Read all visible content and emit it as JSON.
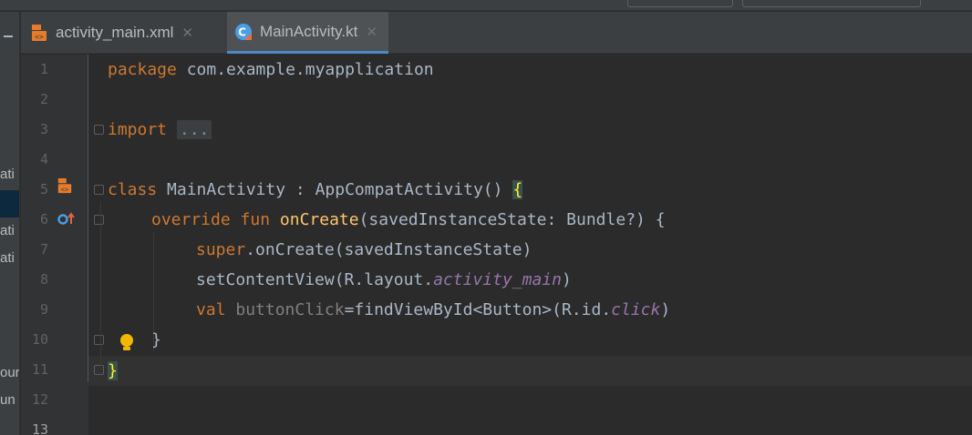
{
  "tabs": [
    {
      "label": "activity_main.xml",
      "icon": "xml-layout-icon",
      "active": false
    },
    {
      "label": "MainActivity.kt",
      "icon": "kotlin-class-icon",
      "active": true
    }
  ],
  "left_panel_fragments": [
    "ati",
    "ati",
    "ati",
    "our",
    "un"
  ],
  "line_numbers": [
    "1",
    "2",
    "3",
    "4",
    "5",
    "6",
    "7",
    "8",
    "9",
    "10",
    "11",
    "12",
    "13"
  ],
  "code": {
    "line1": {
      "kw": "package",
      "rest": " com.example.myapplication"
    },
    "line3": {
      "kw": "import",
      "folded": "..."
    },
    "line7": {
      "kw": "class",
      "rest": " MainActivity : AppCompatActivity() ",
      "brace": "{"
    },
    "line8": {
      "kw": "override fun",
      "fn": "onCreate",
      "rest": "(savedInstanceState: Bundle?) {"
    },
    "line9": {
      "kw": "super",
      "rest": ".onCreate(savedInstanceState)"
    },
    "line10": {
      "pre": "setContentView(R.layout.",
      "it": "activity_main",
      "post": ")"
    },
    "line11": {
      "kw": "val",
      "var": " buttonClick",
      "rest": "=findViewById<Button>(R.id.",
      "it": "click",
      "post": ")"
    },
    "line12": {
      "rest": "}"
    },
    "line13": {
      "brace": "}"
    }
  },
  "colors": {
    "keyword": "#cc7832",
    "function": "#ffc66d",
    "italic_field": "#9876aa",
    "default_text": "#a9b7c6",
    "background": "#2b2b2b"
  }
}
